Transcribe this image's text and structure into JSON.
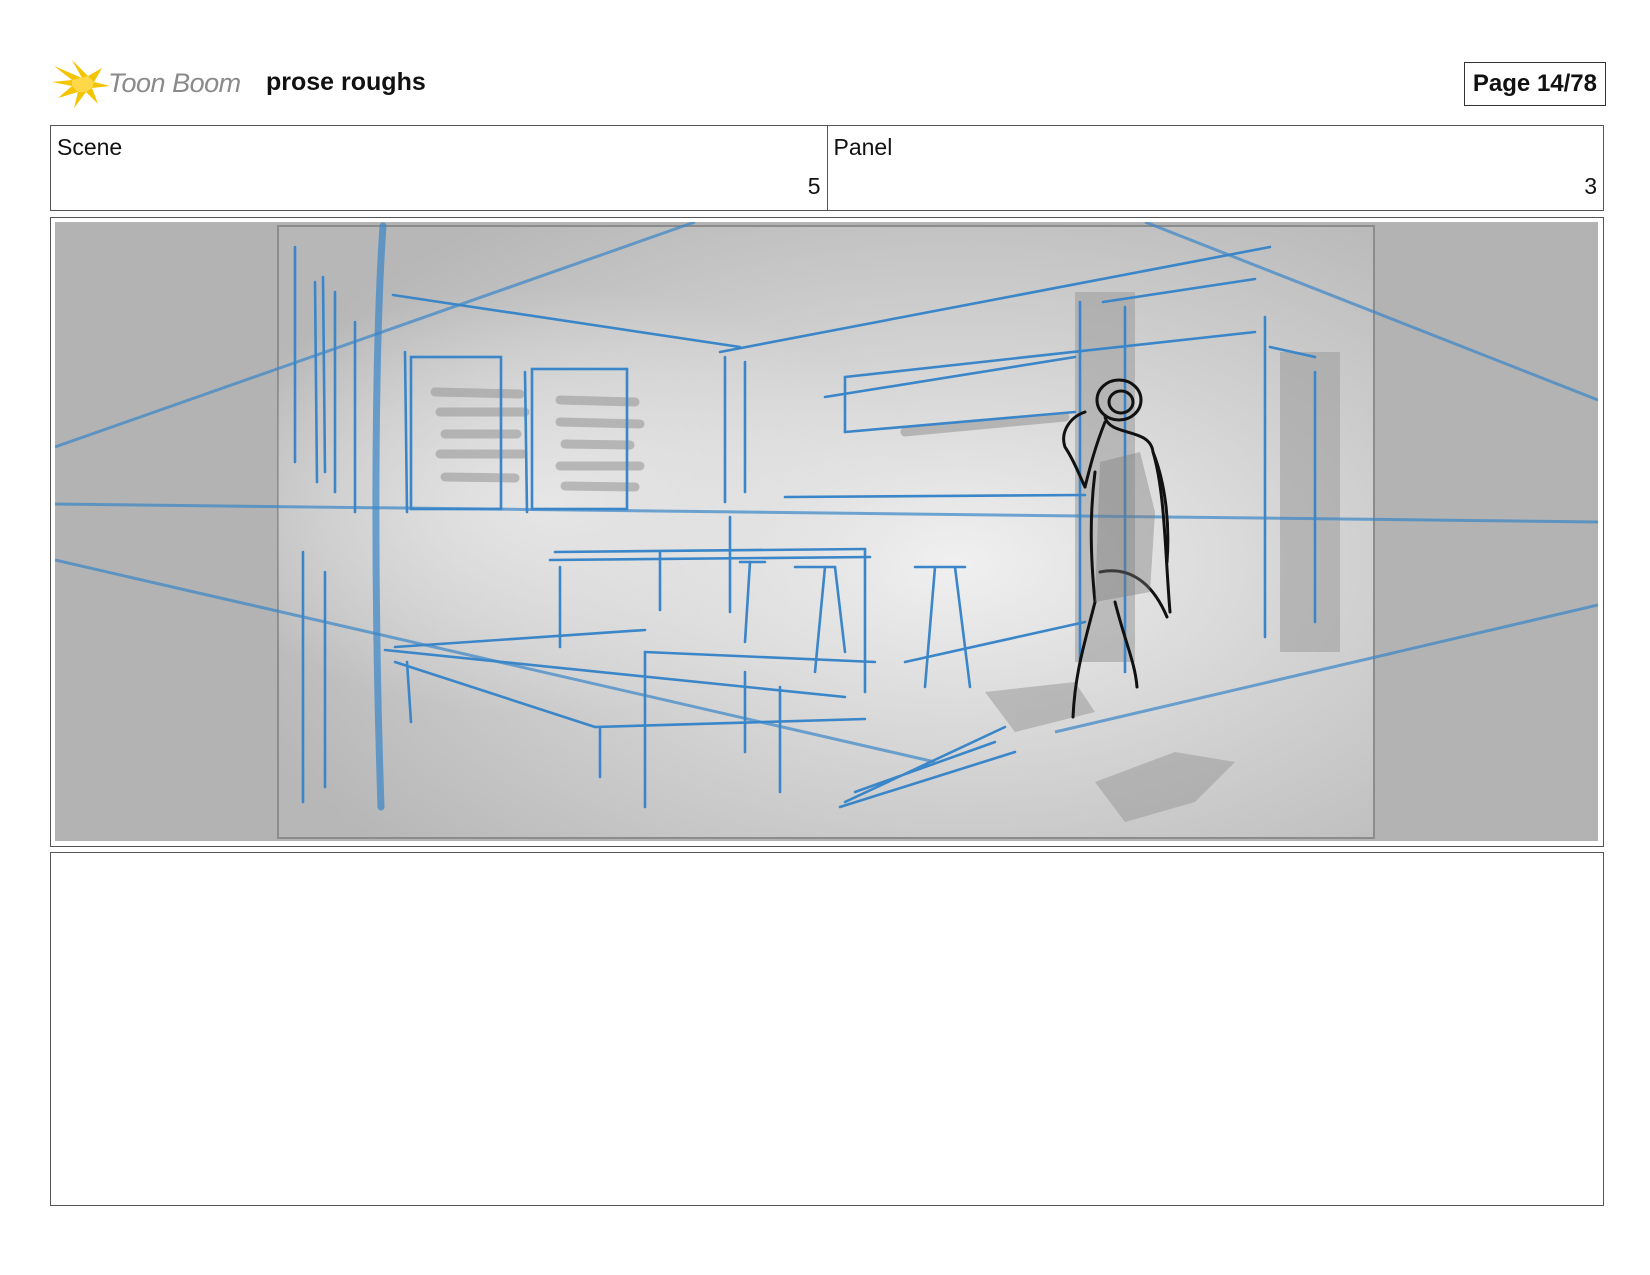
{
  "header": {
    "logo_text": "Toon Boom",
    "project_title": "prose roughs",
    "page_label": "Page 14/78"
  },
  "info": {
    "scene_label": "Scene",
    "scene_value": "5",
    "panel_label": "Panel",
    "panel_value": "3"
  },
  "panel": {
    "description": ""
  },
  "colors": {
    "sketch_blue": "#3a86c8",
    "sketch_black": "#111111",
    "logo_yellow": "#f5c400"
  },
  "icons": {
    "logo": "toon-boom-star-icon"
  }
}
